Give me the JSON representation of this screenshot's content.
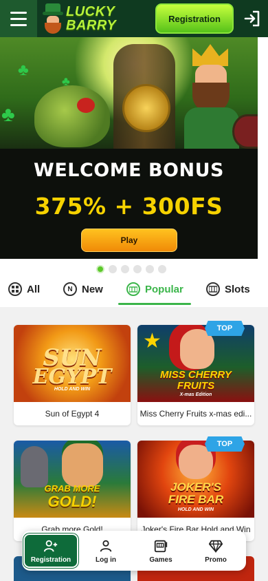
{
  "header": {
    "logo_line1": "LUCKY",
    "logo_line2": "BARRY",
    "registration_label": "Registration"
  },
  "banner": {
    "headline": "WELCOME BONUS",
    "bonus": "375% + 300FS",
    "play_label": "Play",
    "slides": 6,
    "active_slide": 1
  },
  "tabs": [
    {
      "label": "All",
      "icon": "grid-icon"
    },
    {
      "label": "New",
      "icon": "new-icon"
    },
    {
      "label": "Popular",
      "icon": "popular-icon",
      "active": true
    },
    {
      "label": "Slots",
      "icon": "slots-icon"
    }
  ],
  "games": [
    {
      "name": "Sun of Egypt 4",
      "art_line1": "SUN",
      "art_line2": "EGYPT",
      "art_sub": "HOLD AND WIN",
      "badge": ""
    },
    {
      "name": "Miss Cherry Fruits x-mas edi...",
      "art_line1": "MISS CHERRY",
      "art_line2": "FRUITS",
      "art_sub": "X-mas Edition",
      "badge": "TOP"
    },
    {
      "name": "Grab more Gold!",
      "art_line1": "GRAB MORE",
      "art_line2": "GOLD!",
      "art_sub": "",
      "badge": ""
    },
    {
      "name": "Joker's Fire Bar Hold and Win",
      "art_line1": "JOKER'S",
      "art_line2": "FIRE BAR",
      "art_sub": "HOLD AND WIN",
      "badge": "TOP"
    }
  ],
  "bottom_nav": [
    {
      "label": "Registration",
      "icon": "add-user-icon",
      "active": true
    },
    {
      "label": "Log in",
      "icon": "user-icon"
    },
    {
      "label": "Games",
      "icon": "slot-machine-icon"
    },
    {
      "label": "Promo",
      "icon": "diamond-icon"
    }
  ],
  "colors": {
    "brand_green": "#3bb54a",
    "header_bg": "#0f3a20",
    "bonus_yellow": "#f6d200",
    "play_orange": "#f08a07",
    "top_badge": "#2ea4e6"
  }
}
